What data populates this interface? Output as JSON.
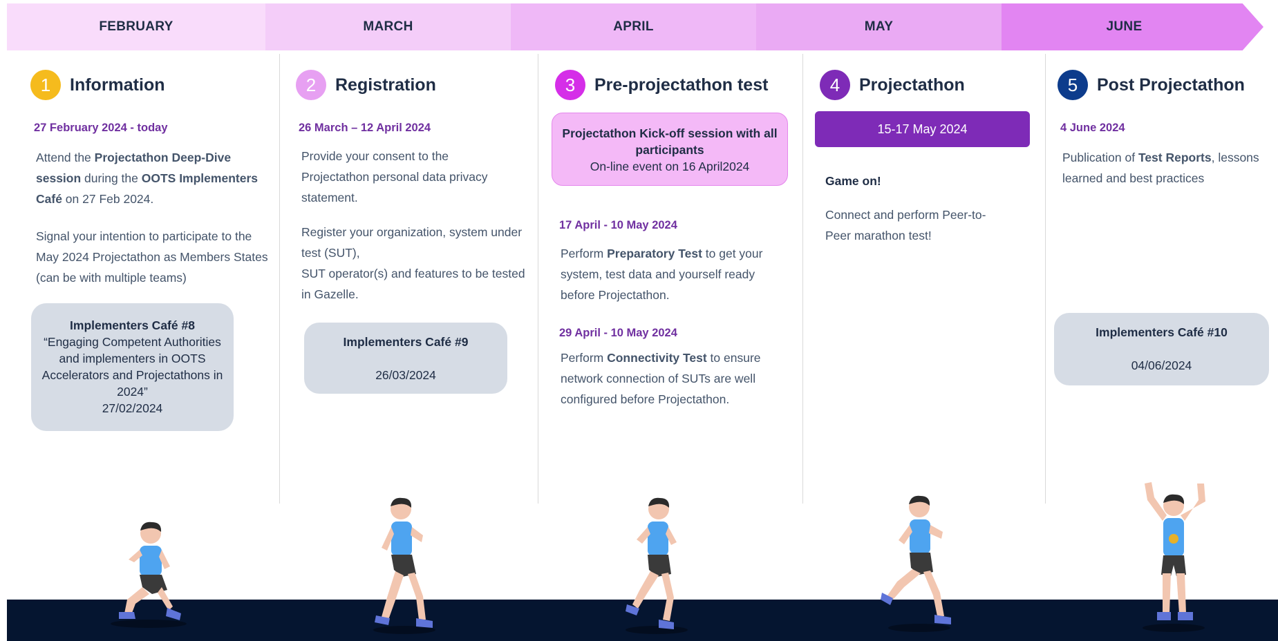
{
  "months": [
    {
      "label": "FEBRUARY",
      "color": "#f9dcfb"
    },
    {
      "label": "MARCH",
      "color": "#f4cdf9"
    },
    {
      "label": "APRIL",
      "color": "#efb8f7"
    },
    {
      "label": "MAY",
      "color": "#eaaaf4"
    },
    {
      "label": "JUNE",
      "color": "#e285f2"
    }
  ],
  "steps": [
    {
      "number": "1",
      "title": "Information",
      "circle_color": "#f5bb1d",
      "date": "27 February 2024 - today",
      "p1": {
        "t1": "Attend the ",
        "b1": "Projectathon Deep-Dive session",
        "t2": " during the ",
        "b2": "OOTS Implementers Café",
        "t3": " on 27 Feb 2024."
      },
      "p2": "Signal your intention to participate to the May 2024 Projectathon as Members States (can be with multiple teams)",
      "cafe": {
        "title": "Implementers Café #8",
        "subtitle": "“Engaging Competent Authorities and implementers in OOTS Accelerators and Projectathons in 2024”",
        "date": "27/02/2024"
      }
    },
    {
      "number": "2",
      "title": "Registration",
      "circle_color": "#e7a0f2",
      "date": "26 March – 12 April 2024",
      "p1": "Provide your consent to the Projectathon personal data privacy statement.",
      "p2": "Register your organization, system under test (SUT),",
      "p3": "SUT operator(s) and features to be tested in Gazelle.",
      "cafe": {
        "title": "Implementers Café #9",
        "date": "26/03/2024"
      }
    },
    {
      "number": "3",
      "title": "Pre-projectathon test",
      "circle_color": "#d52ee8",
      "kickoff": {
        "title": "Projectathon Kick-off session with all participants",
        "text": "On-line event on 16 April2024"
      },
      "date1": "17 April - 10 May 2024",
      "p1": {
        "t1": "Perform ",
        "b1": "Preparatory Test",
        "t2": " to get your system, test data and yourself ready before Projectathon."
      },
      "date2": "29 April - 10 May 2024",
      "p2": {
        "t1": "Perform ",
        "b1": "Connectivity Test",
        "t2": " to ensure network connection of SUTs are well configured before Projectathon."
      }
    },
    {
      "number": "4",
      "title": "Projectathon",
      "circle_color": "#7e2bb7",
      "date_pill": "15-17 May 2024",
      "heading": "Game on!",
      "p1": "Connect and perform Peer-to-Peer marathon test!"
    },
    {
      "number": "5",
      "title": "Post Projectathon",
      "circle_color": "#0d3c8c",
      "date": "4 June 2024",
      "p1": {
        "t1": "Publication of ",
        "b1": "Test Reports",
        "t2": ", lessons learned and best practices"
      },
      "cafe": {
        "title": "Implementers Café #10",
        "date": "04/06/2024"
      }
    }
  ],
  "colors": {
    "skin": "#f2c6b0",
    "shirt": "#4ea4f0",
    "shorts": "#3a3a3a",
    "shoe": "#5f74d8",
    "hair": "#2b2b2b",
    "medal": "#e6b12a"
  }
}
